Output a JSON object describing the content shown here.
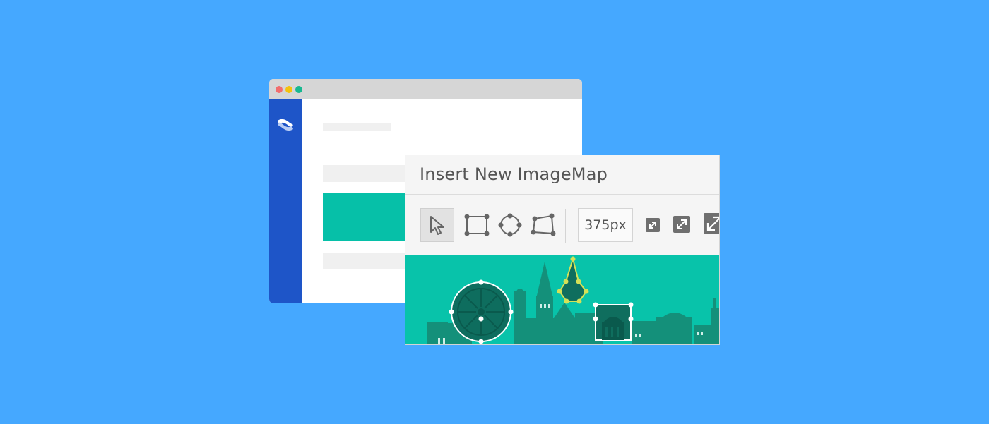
{
  "dialog": {
    "title": "Insert New ImageMap",
    "width_value": "375px"
  },
  "colors": {
    "background": "#45a8ff",
    "sidebar": "#1e55c8",
    "accent": "#06c0a8",
    "highlight": "#d4e157"
  },
  "toolbar": {
    "tools": [
      "select-tool-icon",
      "rectangle-tool-icon",
      "circle-tool-icon",
      "polygon-tool-icon"
    ],
    "size_buttons": [
      "expand-small-icon",
      "expand-medium-icon",
      "expand-large-icon"
    ]
  },
  "browser": {
    "window_controls": [
      "close-dot",
      "minimize-dot",
      "maximize-dot"
    ],
    "logo": "confluence-logo-icon"
  }
}
